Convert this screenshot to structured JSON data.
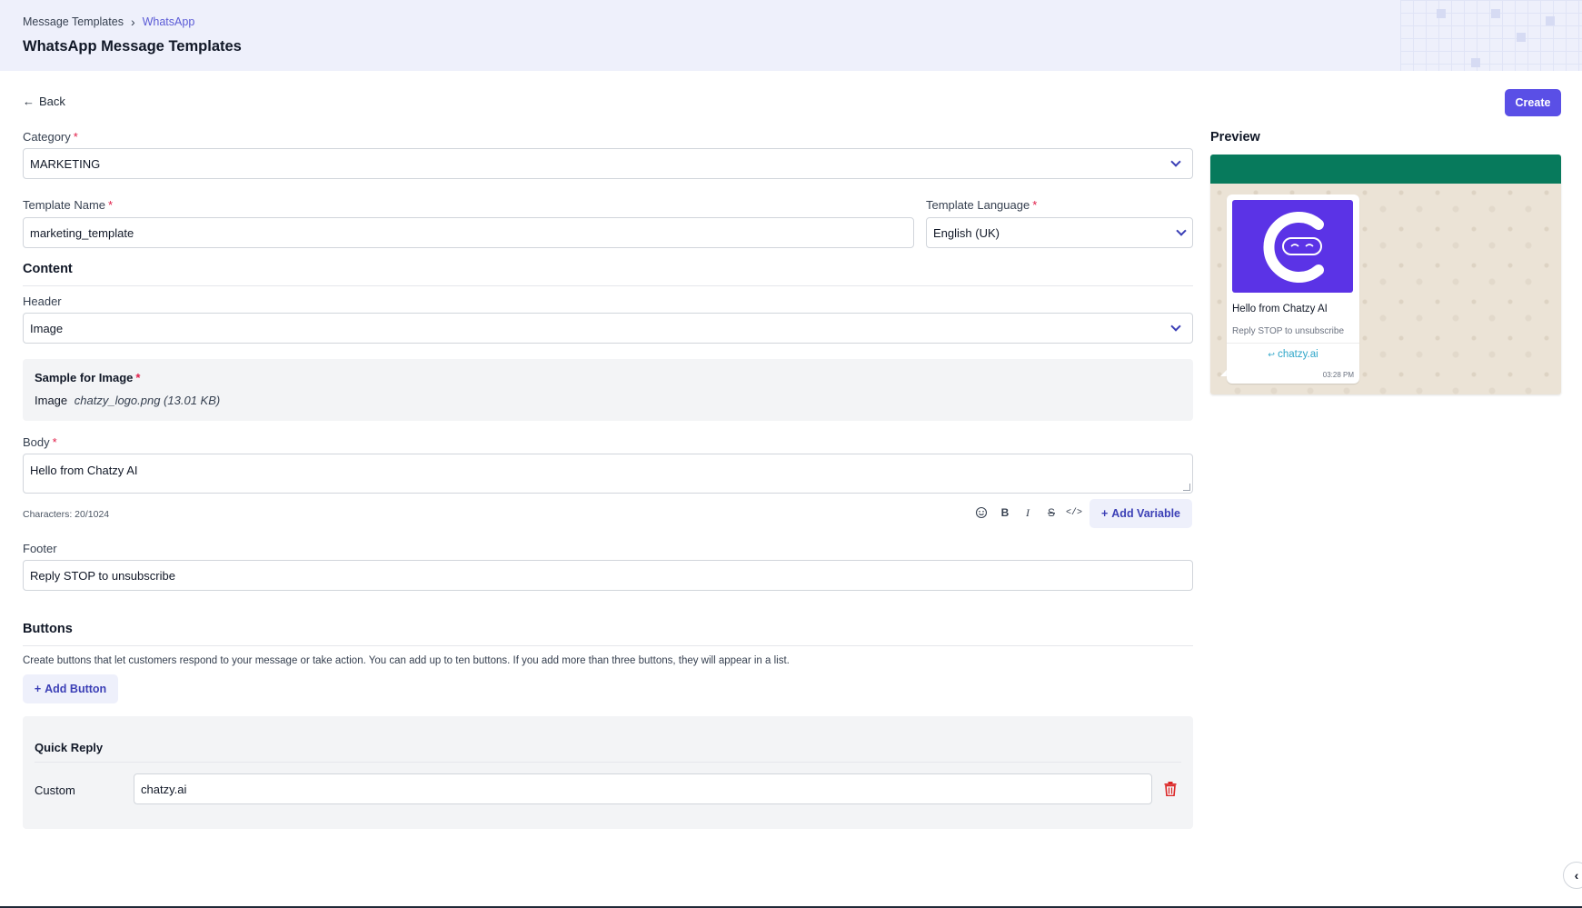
{
  "breadcrumb": {
    "parent": "Message Templates",
    "current": "WhatsApp"
  },
  "page": {
    "title": "WhatsApp Message Templates"
  },
  "actions": {
    "back": "Back",
    "create": "Create"
  },
  "category": {
    "label": "Category",
    "value": "MARKETING"
  },
  "template_name": {
    "label": "Template Name",
    "value": "marketing_template"
  },
  "template_language": {
    "label": "Template Language",
    "value": "English (UK)"
  },
  "content": {
    "heading": "Content",
    "header_label": "Header",
    "header_value": "Image",
    "sample_title": "Sample for Image",
    "sample_type": "Image",
    "sample_file": "chatzy_logo.png (13.01 KB)",
    "body_label": "Body",
    "body_value": "Hello from Chatzy AI",
    "char_count": "Characters: 20/1024",
    "add_variable": "Add Variable",
    "footer_label": "Footer",
    "footer_value": "Reply STOP to unsubscribe"
  },
  "buttons": {
    "heading": "Buttons",
    "description": "Create buttons that let customers respond to your message or take action. You can add up to ten buttons. If you add more than three buttons, they will appear in a list.",
    "add_button": "Add Button",
    "quick_reply_title": "Quick Reply",
    "custom_label": "Custom",
    "custom_value": "chatzy.ai"
  },
  "preview": {
    "heading": "Preview",
    "body": "Hello from Chatzy AI",
    "footer": "Reply STOP to unsubscribe",
    "button": "chatzy.ai",
    "time": "03:28 PM"
  },
  "icons": {
    "back": "arrow-left-icon",
    "chevron": "chevron-down-icon",
    "emoji": "smiley-icon",
    "bold": "bold-icon",
    "italic": "italic-icon",
    "strike": "strikethrough-icon",
    "code": "code-icon",
    "delete": "trash-icon",
    "collapse": "chevron-left-icon"
  },
  "colors": {
    "accent": "#5a4fe6",
    "whatsapp_header": "#077a5c",
    "required": "#e11d48",
    "delete": "#dc2626"
  }
}
